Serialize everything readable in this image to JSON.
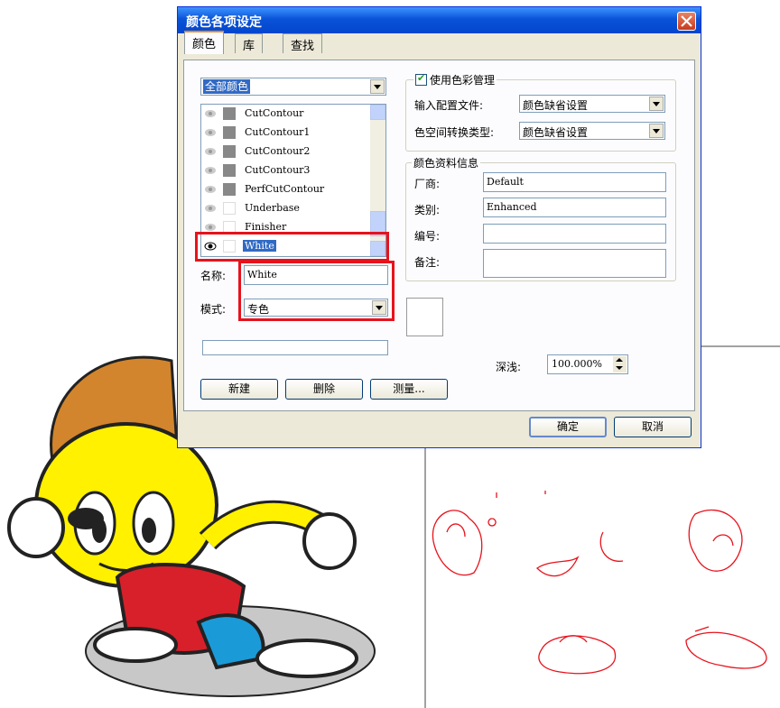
{
  "dialog": {
    "title": "颜色各项设定"
  },
  "tabs": [
    {
      "label": "颜色"
    },
    {
      "label": "库"
    },
    {
      "label": "查找"
    }
  ],
  "left": {
    "filter_combo": "全部颜色",
    "colors": [
      {
        "name": "CutContour",
        "visible": true
      },
      {
        "name": "CutContour1",
        "visible": true
      },
      {
        "name": "CutContour2",
        "visible": true
      },
      {
        "name": "CutContour3",
        "visible": true
      },
      {
        "name": "PerfCutContour",
        "visible": true
      },
      {
        "name": "Underbase",
        "visible": true
      },
      {
        "name": "Finisher",
        "visible": true
      },
      {
        "name": "White",
        "visible": true,
        "selected": true
      }
    ],
    "name_label": "名称:",
    "name_value": "White",
    "mode_label": "模式:",
    "mode_value": "专色",
    "buttons": {
      "new": "新建",
      "delete": "删除",
      "measure": "测量..."
    }
  },
  "right": {
    "use_color_mgmt": "使用色彩管理",
    "input_profile_label": "输入配置文件:",
    "input_profile_value": "颜色缺省设置",
    "cs_convert_label": "色空间转换类型:",
    "cs_convert_value": "颜色缺省设置",
    "info_group_title": "颜色资料信息",
    "vendor_label": "厂商:",
    "vendor_value": "Default",
    "category_label": "类别:",
    "category_value": "Enhanced",
    "number_label": "编号:",
    "number_value": "",
    "notes_label": "备注:",
    "notes_value": "",
    "tint_label": "深浅:",
    "tint_value": "100.000%"
  },
  "footer": {
    "ok": "确定",
    "cancel": "取消"
  },
  "colors": {
    "highlight": "#e8121c",
    "titlebar": "#0a53d8",
    "selection": "#316ac5"
  }
}
